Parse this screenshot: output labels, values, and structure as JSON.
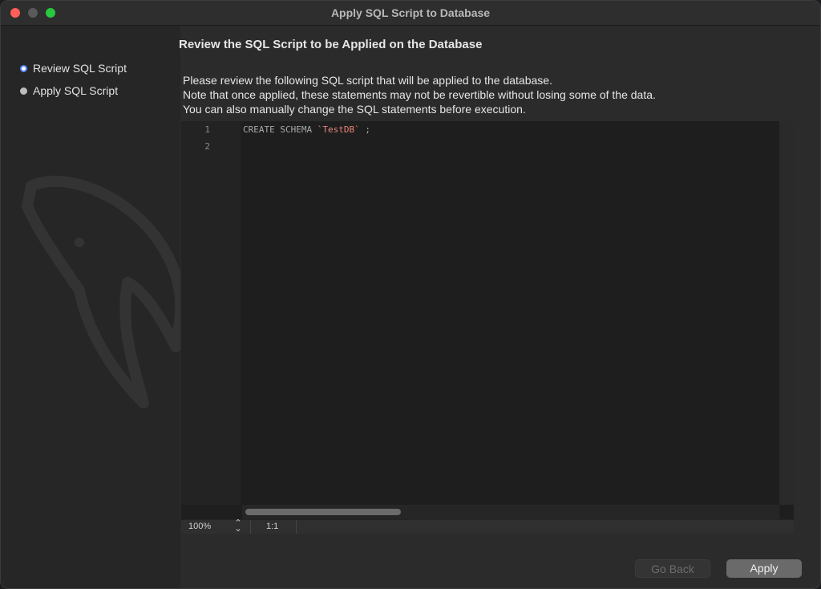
{
  "window": {
    "title": "Apply SQL Script to Database"
  },
  "sidebar": {
    "steps": [
      {
        "label": "Review SQL Script",
        "active": true
      },
      {
        "label": "Apply SQL Script",
        "active": false
      }
    ]
  },
  "main": {
    "heading": "Review the SQL Script to be Applied on the Database",
    "description": [
      "Please review the following SQL script that will be applied to the database.",
      "Note that once applied, these statements may not be revertible without losing some of the data.",
      "You can also manually change the SQL statements before execution."
    ]
  },
  "editor": {
    "line_numbers": [
      "1",
      "2"
    ],
    "line1": {
      "keyword": "CREATE SCHEMA ",
      "identifier": "`TestDB`",
      "terminator": " ;"
    },
    "status": {
      "zoom": "100%",
      "cursor": "1:1"
    }
  },
  "buttons": {
    "back": "Go Back",
    "apply": "Apply"
  },
  "colors": {
    "accent": "#5a87ff",
    "identifier": "#e8847a",
    "close": "#ff5f57",
    "maximize": "#28c840"
  },
  "icons": {
    "logo": "mysql-dolphin-icon",
    "stepper": "up-down-chevron-icon"
  }
}
